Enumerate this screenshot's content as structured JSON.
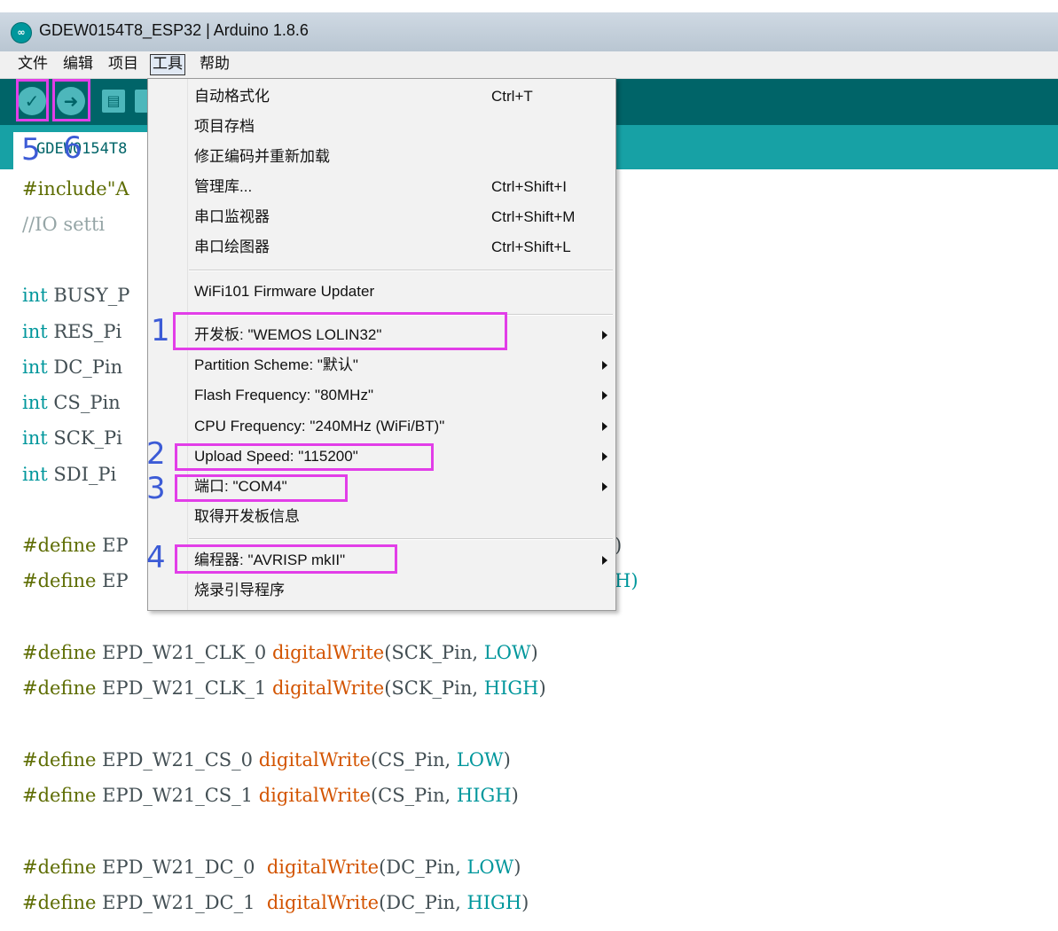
{
  "window": {
    "title": "GDEW0154T8_ESP32 | Arduino 1.8.6",
    "logo_glyph": "∞"
  },
  "menubar": [
    {
      "label": "文件",
      "active": false
    },
    {
      "label": "编辑",
      "active": false
    },
    {
      "label": "项目",
      "active": false
    },
    {
      "label": "工具",
      "active": true
    },
    {
      "label": "帮助",
      "active": false
    }
  ],
  "toolbar": {
    "verify_icon": "✓",
    "upload_icon": "➜",
    "new_icon": "▤",
    "accent": "#006468"
  },
  "tab": {
    "label": "GDEW0154T8"
  },
  "code": [
    "#include\"A",
    "//IO setti",
    "",
    "int BUSY_P",
    "int RES_Pi",
    "int DC_Pin",
    "int CS_Pin",
    "int SCK_Pi",
    "int SDI_Pi",
    "",
    "#define EP",
    "#define EP",
    "",
    "#define EPD_W21_CLK_0 digitalWrite(SCK_Pin, LOW)",
    "#define EPD_W21_CLK_1 digitalWrite(SCK_Pin, HIGH)",
    "",
    "#define EPD_W21_CS_0 digitalWrite(CS_Pin, LOW)",
    "#define EPD_W21_CS_1 digitalWrite(CS_Pin, HIGH)",
    "",
    "#define EPD_W21_DC_0  digitalWrite(DC_Pin, LOW)",
    "#define EPD_W21_DC_1  digitalWrite(DC_Pin, HIGH)"
  ],
  "code_overflow": [
    ")",
    "H)"
  ],
  "tools_menu": {
    "items": [
      {
        "label": "自动格式化",
        "shortcut": "Ctrl+T",
        "submenu": false
      },
      {
        "label": "项目存档",
        "shortcut": "",
        "submenu": false
      },
      {
        "label": "修正编码并重新加载",
        "shortcut": "",
        "submenu": false
      },
      {
        "label": "管理库...",
        "shortcut": "Ctrl+Shift+I",
        "submenu": false
      },
      {
        "label": "串口监视器",
        "shortcut": "Ctrl+Shift+M",
        "submenu": false
      },
      {
        "label": "串口绘图器",
        "shortcut": "Ctrl+Shift+L",
        "submenu": false
      },
      {
        "label": "WiFi101 Firmware Updater",
        "shortcut": "",
        "submenu": false
      },
      {
        "label": "开发板: \"WEMOS LOLIN32\"",
        "shortcut": "",
        "submenu": true
      },
      {
        "label": "Partition Scheme: \"默认\"",
        "shortcut": "",
        "submenu": true
      },
      {
        "label": "Flash Frequency: \"80MHz\"",
        "shortcut": "",
        "submenu": true
      },
      {
        "label": "CPU Frequency: \"240MHz (WiFi/BT)\"",
        "shortcut": "",
        "submenu": true
      },
      {
        "label": "Upload Speed: \"115200\"",
        "shortcut": "",
        "submenu": true
      },
      {
        "label": "端口: \"COM4\"",
        "shortcut": "",
        "submenu": true
      },
      {
        "label": "取得开发板信息",
        "shortcut": "",
        "submenu": false
      },
      {
        "label": "编程器: \"AVRISP mkII\"",
        "shortcut": "",
        "submenu": true
      },
      {
        "label": "烧录引导程序",
        "shortcut": "",
        "submenu": false
      }
    ]
  },
  "annotations": {
    "color": "#e23ee8",
    "number_color": "#3c5bd6",
    "labels": [
      "1",
      "2",
      "3",
      "4",
      "5",
      "6"
    ]
  }
}
